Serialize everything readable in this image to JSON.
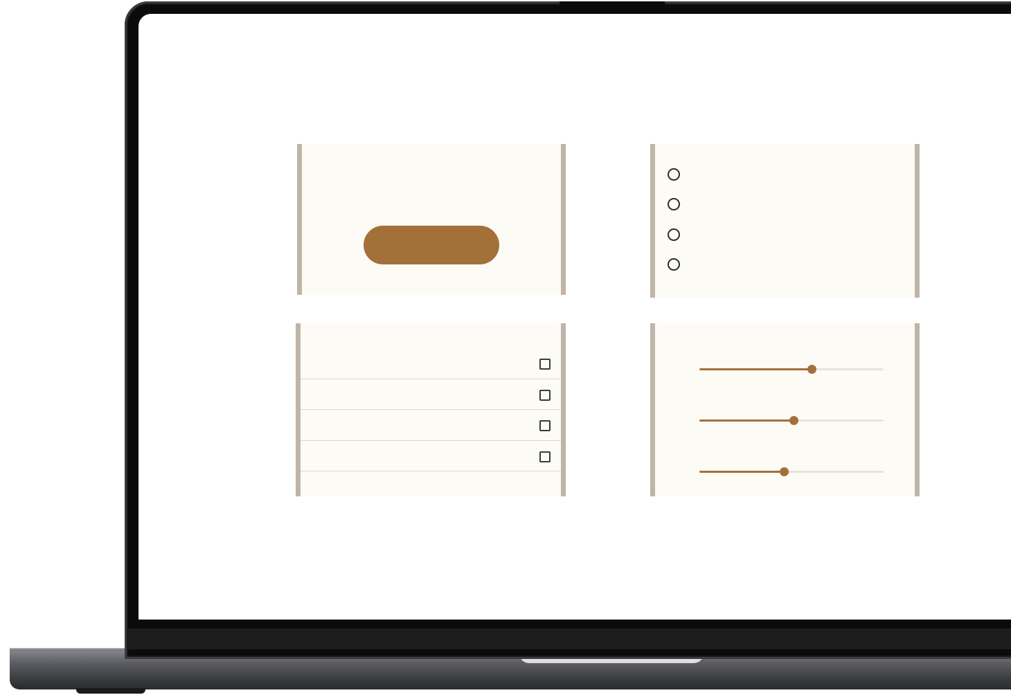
{
  "colors": {
    "accent": "#a47039",
    "panel_background": "#fcfbf6",
    "panel_border": "#bfb4a6",
    "track": "#e6e3dd",
    "divider": "#dcd8d0"
  },
  "button_panel": {
    "button_label": ""
  },
  "radio_panel": {
    "options": [
      {
        "label": "",
        "selected": false
      },
      {
        "label": "",
        "selected": false
      },
      {
        "label": "",
        "selected": false
      },
      {
        "label": "",
        "selected": false
      }
    ]
  },
  "checkbox_panel": {
    "rows": [
      {
        "label": "",
        "checked": false
      },
      {
        "label": "",
        "checked": false
      },
      {
        "label": "",
        "checked": false
      },
      {
        "label": "",
        "checked": false
      }
    ]
  },
  "slider_panel": {
    "sliders": [
      {
        "value_fraction": 0.61
      },
      {
        "value_fraction": 0.51
      },
      {
        "value_fraction": 0.46
      }
    ]
  }
}
